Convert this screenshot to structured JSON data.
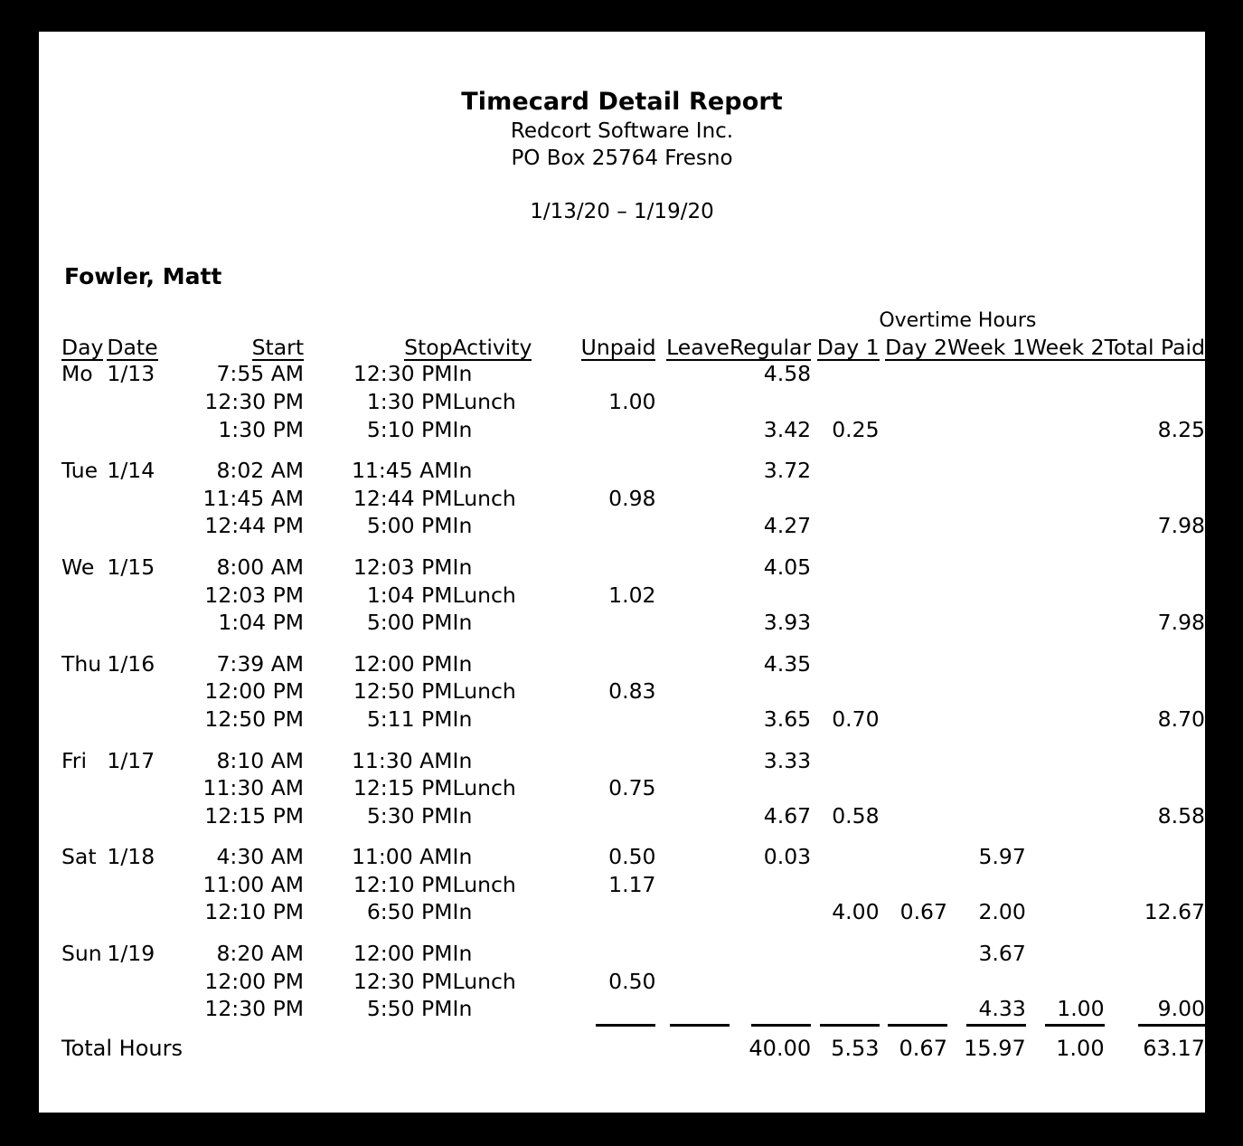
{
  "report": {
    "title": "Timecard Detail Report",
    "company": "Redcort Software Inc.",
    "address": "PO Box 25764  Fresno",
    "period": "1/13/20 – 1/19/20",
    "employee": "Fowler, Matt",
    "total_label": "Total Hours"
  },
  "columns": {
    "overtime_group": "Overtime Hours",
    "day": "Day",
    "date": "Date",
    "start": "Start",
    "stop": "Stop",
    "activity": "Activity",
    "unpaid": "Unpaid",
    "leave": "Leave",
    "regular": "Regular",
    "day1": "Day 1",
    "day2": "Day 2",
    "week1": "Week 1",
    "week2": "Week 2",
    "total_paid": "Total Paid"
  },
  "days": [
    {
      "day": "Mo",
      "date": "1/13",
      "rows": [
        {
          "start": "7:55 AM",
          "stop": "12:30 PM",
          "activity": "In",
          "unpaid": "",
          "leave": "",
          "regular": "4.58",
          "day1": "",
          "day2": "",
          "week1": "",
          "week2": "",
          "total": ""
        },
        {
          "start": "12:30 PM",
          "stop": "1:30 PM",
          "activity": "Lunch",
          "unpaid": "1.00",
          "leave": "",
          "regular": "",
          "day1": "",
          "day2": "",
          "week1": "",
          "week2": "",
          "total": ""
        },
        {
          "start": "1:30 PM",
          "stop": "5:10 PM",
          "activity": "In",
          "unpaid": "",
          "leave": "",
          "regular": "3.42",
          "day1": "0.25",
          "day2": "",
          "week1": "",
          "week2": "",
          "total": "8.25"
        }
      ]
    },
    {
      "day": "Tue",
      "date": "1/14",
      "rows": [
        {
          "start": "8:02 AM",
          "stop": "11:45 AM",
          "activity": "In",
          "unpaid": "",
          "leave": "",
          "regular": "3.72",
          "day1": "",
          "day2": "",
          "week1": "",
          "week2": "",
          "total": ""
        },
        {
          "start": "11:45 AM",
          "stop": "12:44 PM",
          "activity": "Lunch",
          "unpaid": "0.98",
          "leave": "",
          "regular": "",
          "day1": "",
          "day2": "",
          "week1": "",
          "week2": "",
          "total": ""
        },
        {
          "start": "12:44 PM",
          "stop": "5:00 PM",
          "activity": "In",
          "unpaid": "",
          "leave": "",
          "regular": "4.27",
          "day1": "",
          "day2": "",
          "week1": "",
          "week2": "",
          "total": "7.98"
        }
      ]
    },
    {
      "day": "We",
      "date": "1/15",
      "rows": [
        {
          "start": "8:00 AM",
          "stop": "12:03 PM",
          "activity": "In",
          "unpaid": "",
          "leave": "",
          "regular": "4.05",
          "day1": "",
          "day2": "",
          "week1": "",
          "week2": "",
          "total": ""
        },
        {
          "start": "12:03 PM",
          "stop": "1:04 PM",
          "activity": "Lunch",
          "unpaid": "1.02",
          "leave": "",
          "regular": "",
          "day1": "",
          "day2": "",
          "week1": "",
          "week2": "",
          "total": ""
        },
        {
          "start": "1:04 PM",
          "stop": "5:00 PM",
          "activity": "In",
          "unpaid": "",
          "leave": "",
          "regular": "3.93",
          "day1": "",
          "day2": "",
          "week1": "",
          "week2": "",
          "total": "7.98"
        }
      ]
    },
    {
      "day": "Thu",
      "date": "1/16",
      "rows": [
        {
          "start": "7:39 AM",
          "stop": "12:00 PM",
          "activity": "In",
          "unpaid": "",
          "leave": "",
          "regular": "4.35",
          "day1": "",
          "day2": "",
          "week1": "",
          "week2": "",
          "total": ""
        },
        {
          "start": "12:00 PM",
          "stop": "12:50 PM",
          "activity": "Lunch",
          "unpaid": "0.83",
          "leave": "",
          "regular": "",
          "day1": "",
          "day2": "",
          "week1": "",
          "week2": "",
          "total": ""
        },
        {
          "start": "12:50 PM",
          "stop": "5:11 PM",
          "activity": "In",
          "unpaid": "",
          "leave": "",
          "regular": "3.65",
          "day1": "0.70",
          "day2": "",
          "week1": "",
          "week2": "",
          "total": "8.70"
        }
      ]
    },
    {
      "day": "Fri",
      "date": "1/17",
      "rows": [
        {
          "start": "8:10 AM",
          "stop": "11:30 AM",
          "activity": "In",
          "unpaid": "",
          "leave": "",
          "regular": "3.33",
          "day1": "",
          "day2": "",
          "week1": "",
          "week2": "",
          "total": ""
        },
        {
          "start": "11:30 AM",
          "stop": "12:15 PM",
          "activity": "Lunch",
          "unpaid": "0.75",
          "leave": "",
          "regular": "",
          "day1": "",
          "day2": "",
          "week1": "",
          "week2": "",
          "total": ""
        },
        {
          "start": "12:15 PM",
          "stop": "5:30 PM",
          "activity": "In",
          "unpaid": "",
          "leave": "",
          "regular": "4.67",
          "day1": "0.58",
          "day2": "",
          "week1": "",
          "week2": "",
          "total": "8.58"
        }
      ]
    },
    {
      "day": "Sat",
      "date": "1/18",
      "rows": [
        {
          "start": "4:30 AM",
          "stop": "11:00 AM",
          "activity": "In",
          "unpaid": "0.50",
          "leave": "",
          "regular": "0.03",
          "day1": "",
          "day2": "",
          "week1": "5.97",
          "week2": "",
          "total": ""
        },
        {
          "start": "11:00 AM",
          "stop": "12:10 PM",
          "activity": "Lunch",
          "unpaid": "1.17",
          "leave": "",
          "regular": "",
          "day1": "",
          "day2": "",
          "week1": "",
          "week2": "",
          "total": ""
        },
        {
          "start": "12:10 PM",
          "stop": "6:50 PM",
          "activity": "In",
          "unpaid": "",
          "leave": "",
          "regular": "",
          "day1": "4.00",
          "day2": "0.67",
          "week1": "2.00",
          "week2": "",
          "total": "12.67"
        }
      ]
    },
    {
      "day": "Sun",
      "date": "1/19",
      "rows": [
        {
          "start": "8:20 AM",
          "stop": "12:00 PM",
          "activity": "In",
          "unpaid": "",
          "leave": "",
          "regular": "",
          "day1": "",
          "day2": "",
          "week1": "3.67",
          "week2": "",
          "total": ""
        },
        {
          "start": "12:00 PM",
          "stop": "12:30 PM",
          "activity": "Lunch",
          "unpaid": "0.50",
          "leave": "",
          "regular": "",
          "day1": "",
          "day2": "",
          "week1": "",
          "week2": "",
          "total": ""
        },
        {
          "start": "12:30 PM",
          "stop": "5:50 PM",
          "activity": "In",
          "unpaid": "",
          "leave": "",
          "regular": "",
          "day1": "",
          "day2": "",
          "week1": "4.33",
          "week2": "1.00",
          "total": "9.00"
        }
      ]
    }
  ],
  "totals": {
    "unpaid": "",
    "leave": "",
    "regular": "40.00",
    "day1": "5.53",
    "day2": "0.67",
    "week1": "15.97",
    "week2": "1.00",
    "total": "63.17"
  }
}
